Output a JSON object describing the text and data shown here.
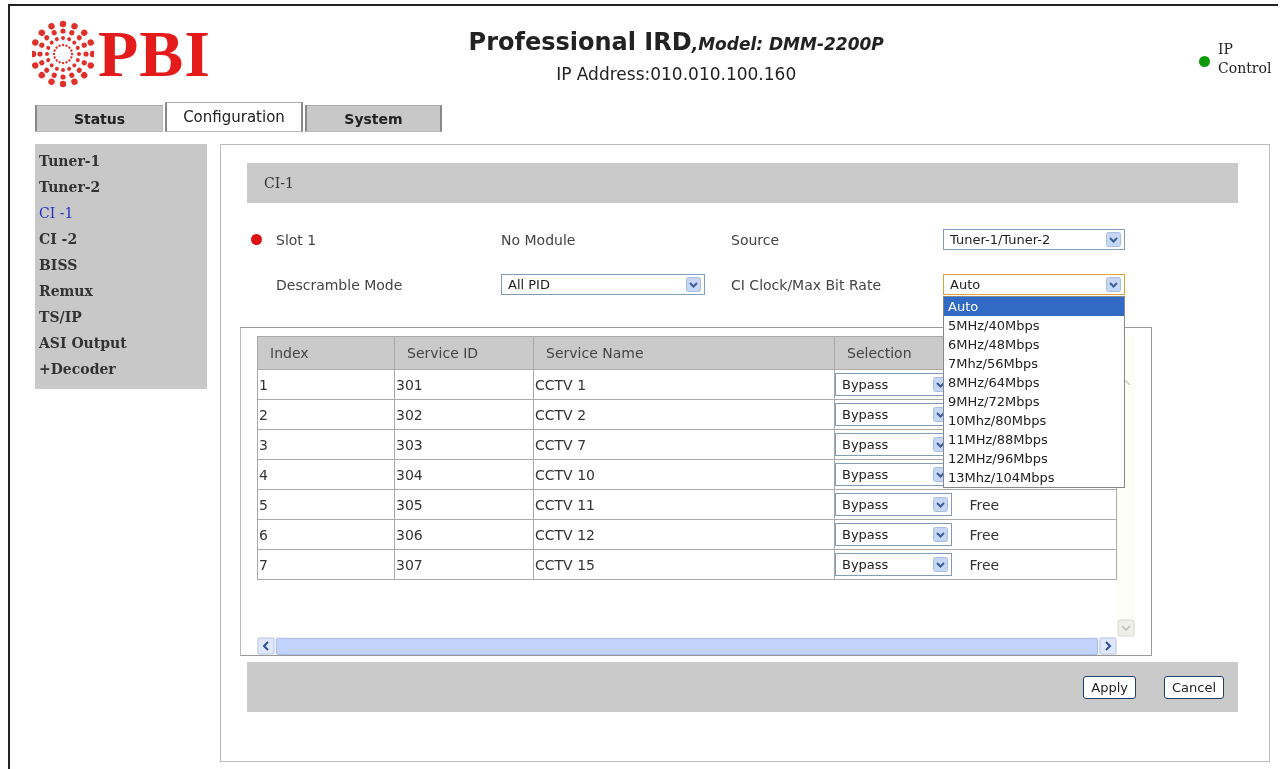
{
  "header": {
    "logo": "PBI",
    "title": "Professional IRD",
    "model": ",Model: DMM-2200P",
    "ip_address": "IP Address:010.010.100.160",
    "ip_control": {
      "label": "IP Control",
      "on": true
    }
  },
  "tabs": [
    {
      "label": "Status",
      "selected": false
    },
    {
      "label": "Configuration",
      "selected": true
    },
    {
      "label": "System",
      "selected": false
    }
  ],
  "sidebar": {
    "items": [
      {
        "label": "Tuner-1",
        "selected": false
      },
      {
        "label": "Tuner-2",
        "selected": false
      },
      {
        "label": "CI -1",
        "selected": true
      },
      {
        "label": "CI -2",
        "selected": false
      },
      {
        "label": "BISS",
        "selected": false
      },
      {
        "label": "Remux",
        "selected": false
      },
      {
        "label": "TS/IP",
        "selected": false
      },
      {
        "label": "ASI Output",
        "selected": false
      },
      {
        "label": "+Decoder",
        "selected": false
      }
    ]
  },
  "section": {
    "title": "CI-1"
  },
  "slot": {
    "label": "Slot 1",
    "status": "No Module",
    "alarm": true
  },
  "source": {
    "label": "Source",
    "value": "Tuner-1/Tuner-2"
  },
  "descramble_mode": {
    "label": "Descramble Mode",
    "value": "All PID"
  },
  "ci_clock": {
    "label": "CI Clock/Max Bit Rate",
    "value": "Auto",
    "expanded": true,
    "options": [
      {
        "label": "Auto",
        "selected": true
      },
      {
        "label": "5MHz/40Mbps",
        "selected": false
      },
      {
        "label": "6MHz/48Mbps",
        "selected": false
      },
      {
        "label": "7Mhz/56Mbps",
        "selected": false
      },
      {
        "label": "8MHz/64Mbps",
        "selected": false
      },
      {
        "label": "9MHz/72Mbps",
        "selected": false
      },
      {
        "label": "10Mhz/80Mbps",
        "selected": false
      },
      {
        "label": "11MHz/88Mbps",
        "selected": false
      },
      {
        "label": "12MHz/96Mbps",
        "selected": false
      },
      {
        "label": "13Mhz/104Mbps",
        "selected": false
      }
    ]
  },
  "table": {
    "columns": [
      "Index",
      "Service ID",
      "Service Name",
      "Selection"
    ],
    "rows": [
      {
        "index": "1",
        "service_id": "301",
        "name": "CCTV 1",
        "selection": "Bypass"
      },
      {
        "index": "2",
        "service_id": "302",
        "name": "CCTV 2",
        "selection": "Bypass"
      },
      {
        "index": "3",
        "service_id": "303",
        "name": "CCTV 7",
        "selection": "Bypass"
      },
      {
        "index": "4",
        "service_id": "304",
        "name": "CCTV 10",
        "selection": "Bypass"
      },
      {
        "index": "5",
        "service_id": "305",
        "name": "CCTV 11",
        "selection": "Bypass",
        "status": "Free"
      },
      {
        "index": "6",
        "service_id": "306",
        "name": "CCTV 12",
        "selection": "Bypass",
        "status": "Free"
      },
      {
        "index": "7",
        "service_id": "307",
        "name": "CCTV 15",
        "selection": "Bypass",
        "status": "Free"
      }
    ]
  },
  "buttons": [
    "Apply",
    "Cancel"
  ]
}
